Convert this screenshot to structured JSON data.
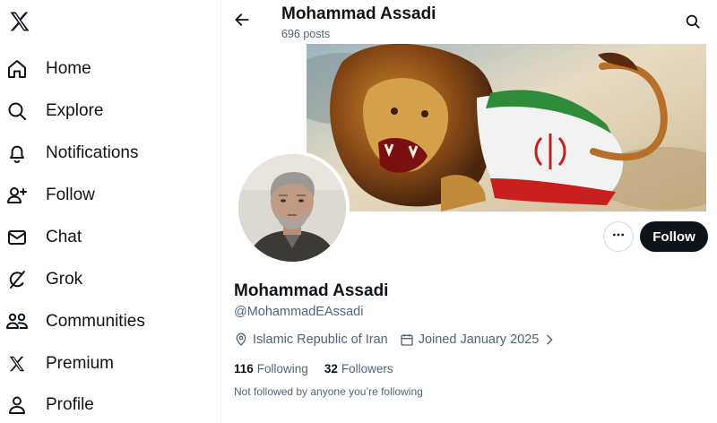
{
  "sidebar": {
    "logo_icon": "x-logo-icon",
    "items": [
      {
        "label": "Home",
        "icon": "home-icon"
      },
      {
        "label": "Explore",
        "icon": "search-icon"
      },
      {
        "label": "Notifications",
        "icon": "bell-icon"
      },
      {
        "label": "Follow",
        "icon": "person-add-icon"
      },
      {
        "label": "Chat",
        "icon": "mail-icon"
      },
      {
        "label": "Grok",
        "icon": "grok-icon"
      },
      {
        "label": "Communities",
        "icon": "people-icon"
      },
      {
        "label": "Premium",
        "icon": "x-logo-icon"
      },
      {
        "label": "Profile",
        "icon": "person-icon"
      }
    ]
  },
  "header": {
    "title": "Mohammad Assadi",
    "post_count": "696 posts"
  },
  "profile": {
    "display_name": "Mohammad Assadi",
    "handle": "@MohammadEAssadi",
    "location": "Islamic Republic of Iran",
    "joined": "Joined January 2025",
    "following_count": "116",
    "following_label": "Following",
    "followers_count": "32",
    "followers_label": "Followers",
    "not_followed_text": "Not followed by anyone you’re following"
  },
  "actions": {
    "more_icon": "more-horizontal-icon",
    "follow_label": "Follow"
  },
  "colors": {
    "text_primary": "#0f1419",
    "text_secondary": "#536471",
    "button_dark": "#0f1419",
    "border": "#cfd9de"
  }
}
